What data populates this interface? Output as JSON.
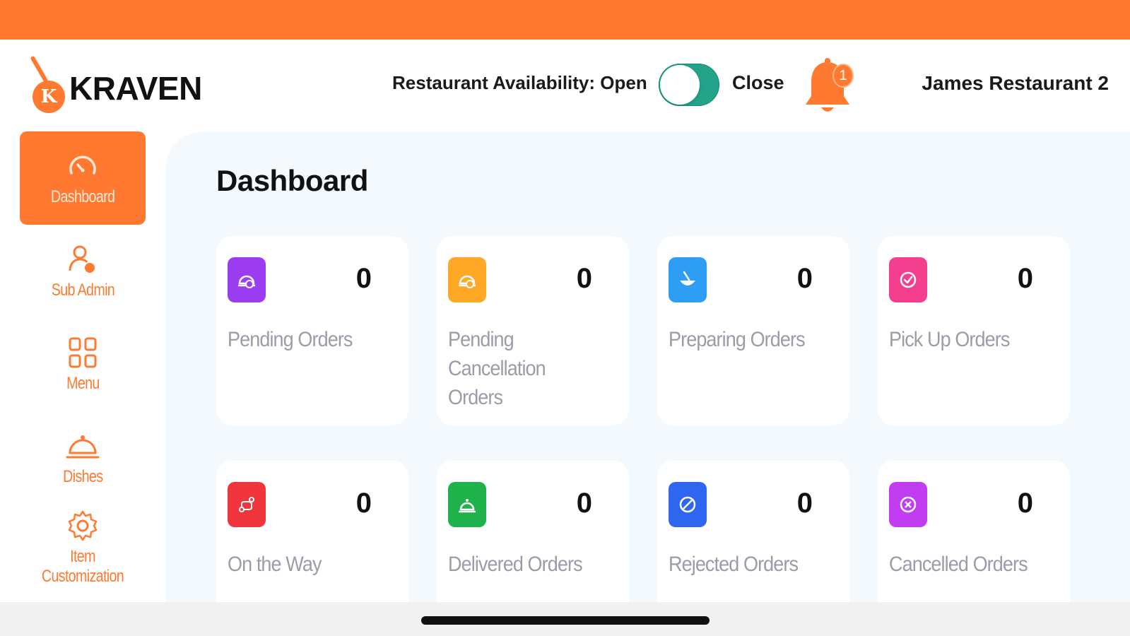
{
  "brand": {
    "name": "KRAVEN",
    "logo_letter": "K",
    "accent_color": "#ff7a30"
  },
  "header": {
    "availability_label": "Restaurant Availability: Open",
    "toggle_state": "open",
    "close_label": "Close",
    "notification_count": "1",
    "restaurant_name": "James Restaurant 2"
  },
  "sidebar": {
    "items": [
      {
        "label": "Dashboard",
        "icon": "speedometer-icon",
        "active": true
      },
      {
        "label": "Sub Admin",
        "icon": "user-gear-icon",
        "active": false
      },
      {
        "label": "Menu",
        "icon": "grid-icon",
        "active": false
      },
      {
        "label": "Dishes",
        "icon": "cloche-icon",
        "active": false
      },
      {
        "label": "Item Customization",
        "icon": "gear-icon",
        "active": false
      }
    ]
  },
  "main": {
    "title": "Dashboard",
    "cards": [
      {
        "label": "Pending Orders",
        "count": "0",
        "icon": "pending-orders-icon",
        "color": "#9b3cf0"
      },
      {
        "label": "Pending Cancellation Orders",
        "count": "0",
        "icon": "pending-cancellation-icon",
        "color": "#ffa826"
      },
      {
        "label": "Preparing Orders",
        "count": "0",
        "icon": "preparing-orders-icon",
        "color": "#2e9df4"
      },
      {
        "label": "Pick Up Orders",
        "count": "0",
        "icon": "pickup-check-icon",
        "color": "#f43f8e"
      },
      {
        "label": "On the Way",
        "count": "0",
        "icon": "route-icon",
        "color": "#f0363c"
      },
      {
        "label": "Delivered Orders",
        "count": "0",
        "icon": "delivered-icon",
        "color": "#1fb14a"
      },
      {
        "label": "Rejected Orders",
        "count": "0",
        "icon": "rejected-icon",
        "color": "#2f66f0"
      },
      {
        "label": "Cancelled Orders",
        "count": "0",
        "icon": "cancelled-icon",
        "color": "#c23cf2"
      }
    ]
  }
}
